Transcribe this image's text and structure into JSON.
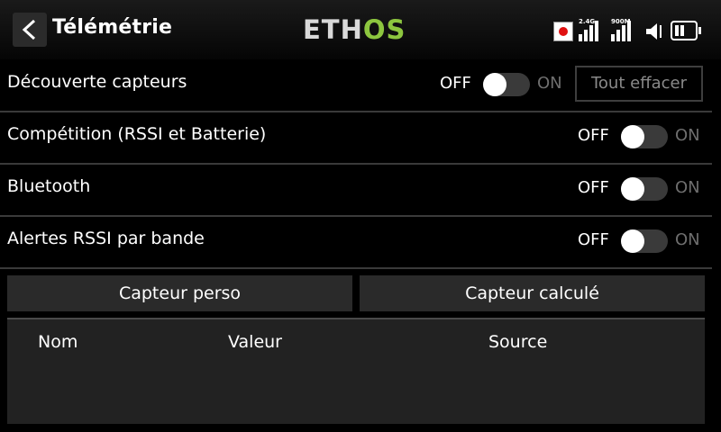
{
  "header": {
    "title": "Télémétrie",
    "logo_main": "ETH",
    "logo_accent": "OS",
    "status": {
      "band1": "2.4G",
      "band2": "900M"
    }
  },
  "settings": [
    {
      "label": "Découverte capteurs",
      "off": "OFF",
      "on": "ON",
      "state": "off"
    },
    {
      "label": "Compétition (RSSI et Batterie)",
      "off": "OFF",
      "on": "ON",
      "state": "off"
    },
    {
      "label": "Bluetooth",
      "off": "OFF",
      "on": "ON",
      "state": "off"
    },
    {
      "label": "Alertes RSSI par bande",
      "off": "OFF",
      "on": "ON",
      "state": "off"
    }
  ],
  "clear_button": "Tout effacer",
  "buttons": {
    "custom_sensor": "Capteur perso",
    "calculated_sensor": "Capteur calculé"
  },
  "table": {
    "columns": [
      "Nom",
      "Valeur",
      "Source"
    ]
  },
  "colors": {
    "accent": "#8dc63f",
    "record": "#e01010"
  }
}
